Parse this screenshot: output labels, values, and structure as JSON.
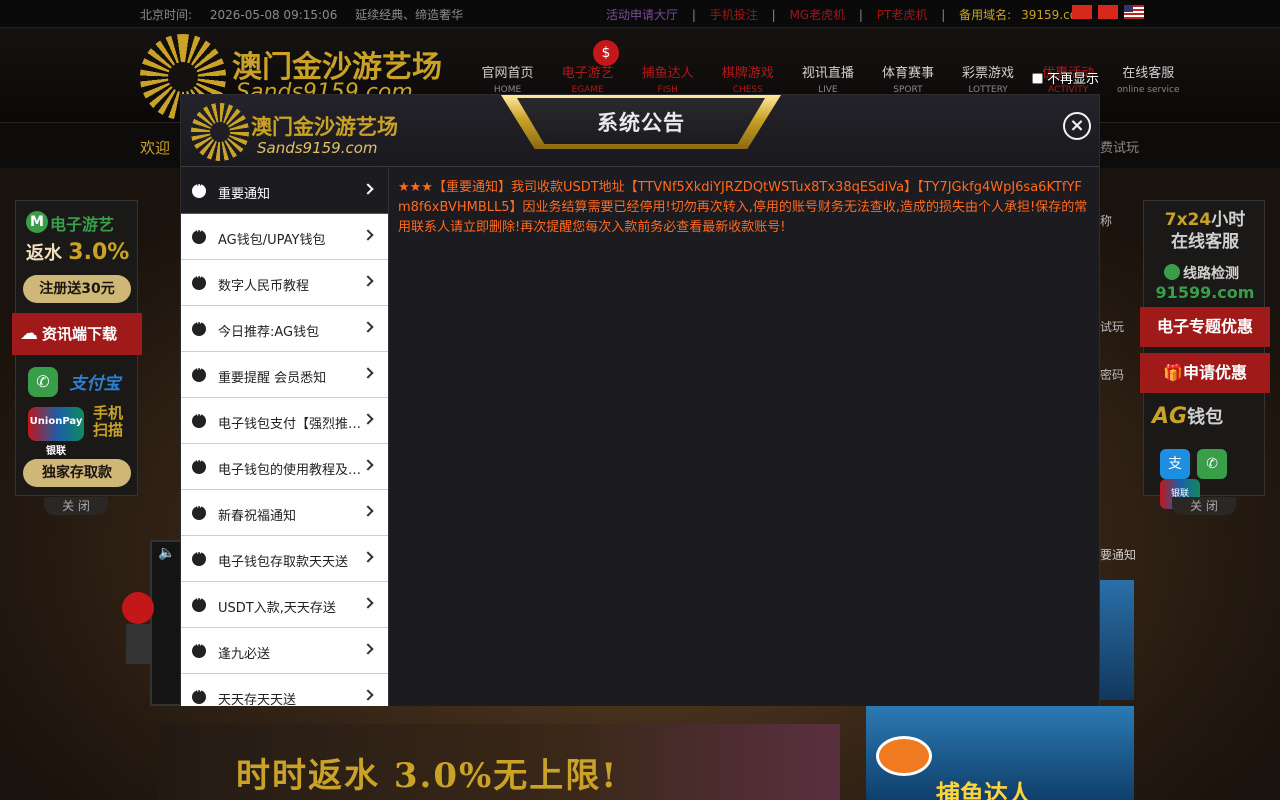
{
  "topbar": {
    "time_label": "北京时间:",
    "time_value": "2026-05-08 09:15:06",
    "slogan": "延续经典、缔造奢华",
    "links": [
      "活动申请大厅",
      "手机投注",
      "MG老虎机",
      "PT老虎机"
    ],
    "domain_label": "备用域名:",
    "domain_value": "39159.com",
    "separator": "|"
  },
  "brand": {
    "name_cn": "澳门金沙游艺场",
    "name_en": "Sands9159.com"
  },
  "nav": [
    {
      "cn": "官网首页",
      "en": "HOME"
    },
    {
      "cn": "电子游艺",
      "en": "EGAME"
    },
    {
      "cn": "捕鱼达人",
      "en": "FISH"
    },
    {
      "cn": "棋牌游戏",
      "en": "CHESS"
    },
    {
      "cn": "视讯直播",
      "en": "LIVE"
    },
    {
      "cn": "体育赛事",
      "en": "SPORT"
    },
    {
      "cn": "彩票游戏",
      "en": "LOTTERY"
    },
    {
      "cn": "优惠活动",
      "en": "ACTIVITY"
    },
    {
      "cn": "在线客服",
      "en": "online service"
    }
  ],
  "subbar": {
    "welcome": "欢迎",
    "trial": "费试玩"
  },
  "left_float": {
    "slot_name": "电子游艺",
    "rebate_prefix": "返水",
    "rebate_value": "3.0%",
    "register_bonus": "注册送30元",
    "download": "资讯端下载",
    "alipay": "支付宝",
    "unionpay": "UnionPay 银联",
    "scan": "手机 扫描",
    "deposit": "独家存取款",
    "close": "关 闭"
  },
  "right_float": {
    "hours": "7x24",
    "hours_suffix": "小时",
    "service": "在线客服",
    "line_check": "线路检测",
    "domain": "91599.com",
    "slot_offer": "电子专题优惠",
    "apply_offer": "申请优惠",
    "ag_wallet": "钱包",
    "ag_label": "AG",
    "close": "关 闭"
  },
  "background_fragments": {
    "nickname": "称",
    "play": "试玩",
    "password": "密码",
    "notice": "要通知",
    "hero_text": "时时返水 3.0%无上限!",
    "fish_text": "捕鱼达人"
  },
  "modal": {
    "title": "系统公告",
    "dont_show_again": "不再显示",
    "close_symbol": "×",
    "logo_cn": "澳门金沙游艺场",
    "logo_en": "Sands9159.com",
    "items": [
      {
        "label": "重要通知",
        "active": true
      },
      {
        "label": "AG钱包/UPAY钱包",
        "active": false
      },
      {
        "label": "数字人民币教程",
        "active": false
      },
      {
        "label": "今日推荐:AG钱包",
        "active": false
      },
      {
        "label": "重要提醒 会员悉知",
        "active": false
      },
      {
        "label": "电子钱包支付【强烈推荐】",
        "active": false
      },
      {
        "label": "电子钱包的使用教程及说明",
        "active": false
      },
      {
        "label": "新春祝福通知",
        "active": false
      },
      {
        "label": "电子钱包存取款天天送",
        "active": false
      },
      {
        "label": "USDT入款,天天存送",
        "active": false
      },
      {
        "label": "逢九必送",
        "active": false
      },
      {
        "label": "天天存天天送",
        "active": false
      }
    ],
    "content": "★★★【重要通知】我司收款USDT地址【TTVNf5XkdiYJRZDQtWSTux8Tx38qESdiVa】【TY7JGkfg4WpJ6sa6KTfYFm8f6xBVHMBLL5】因业务结算需要已经停用!切勿再次转入,停用的账号财务无法查收,造成的损失由个人承担!保存的常用联系人请立即删除!再次提醒您每次入款前务必查看最新收款账号!"
  },
  "colors": {
    "gold": "#c9a227",
    "announcement_text": "#ff6a1f",
    "modal_bg": "#1c1b20",
    "hot_red": "#b01818"
  }
}
